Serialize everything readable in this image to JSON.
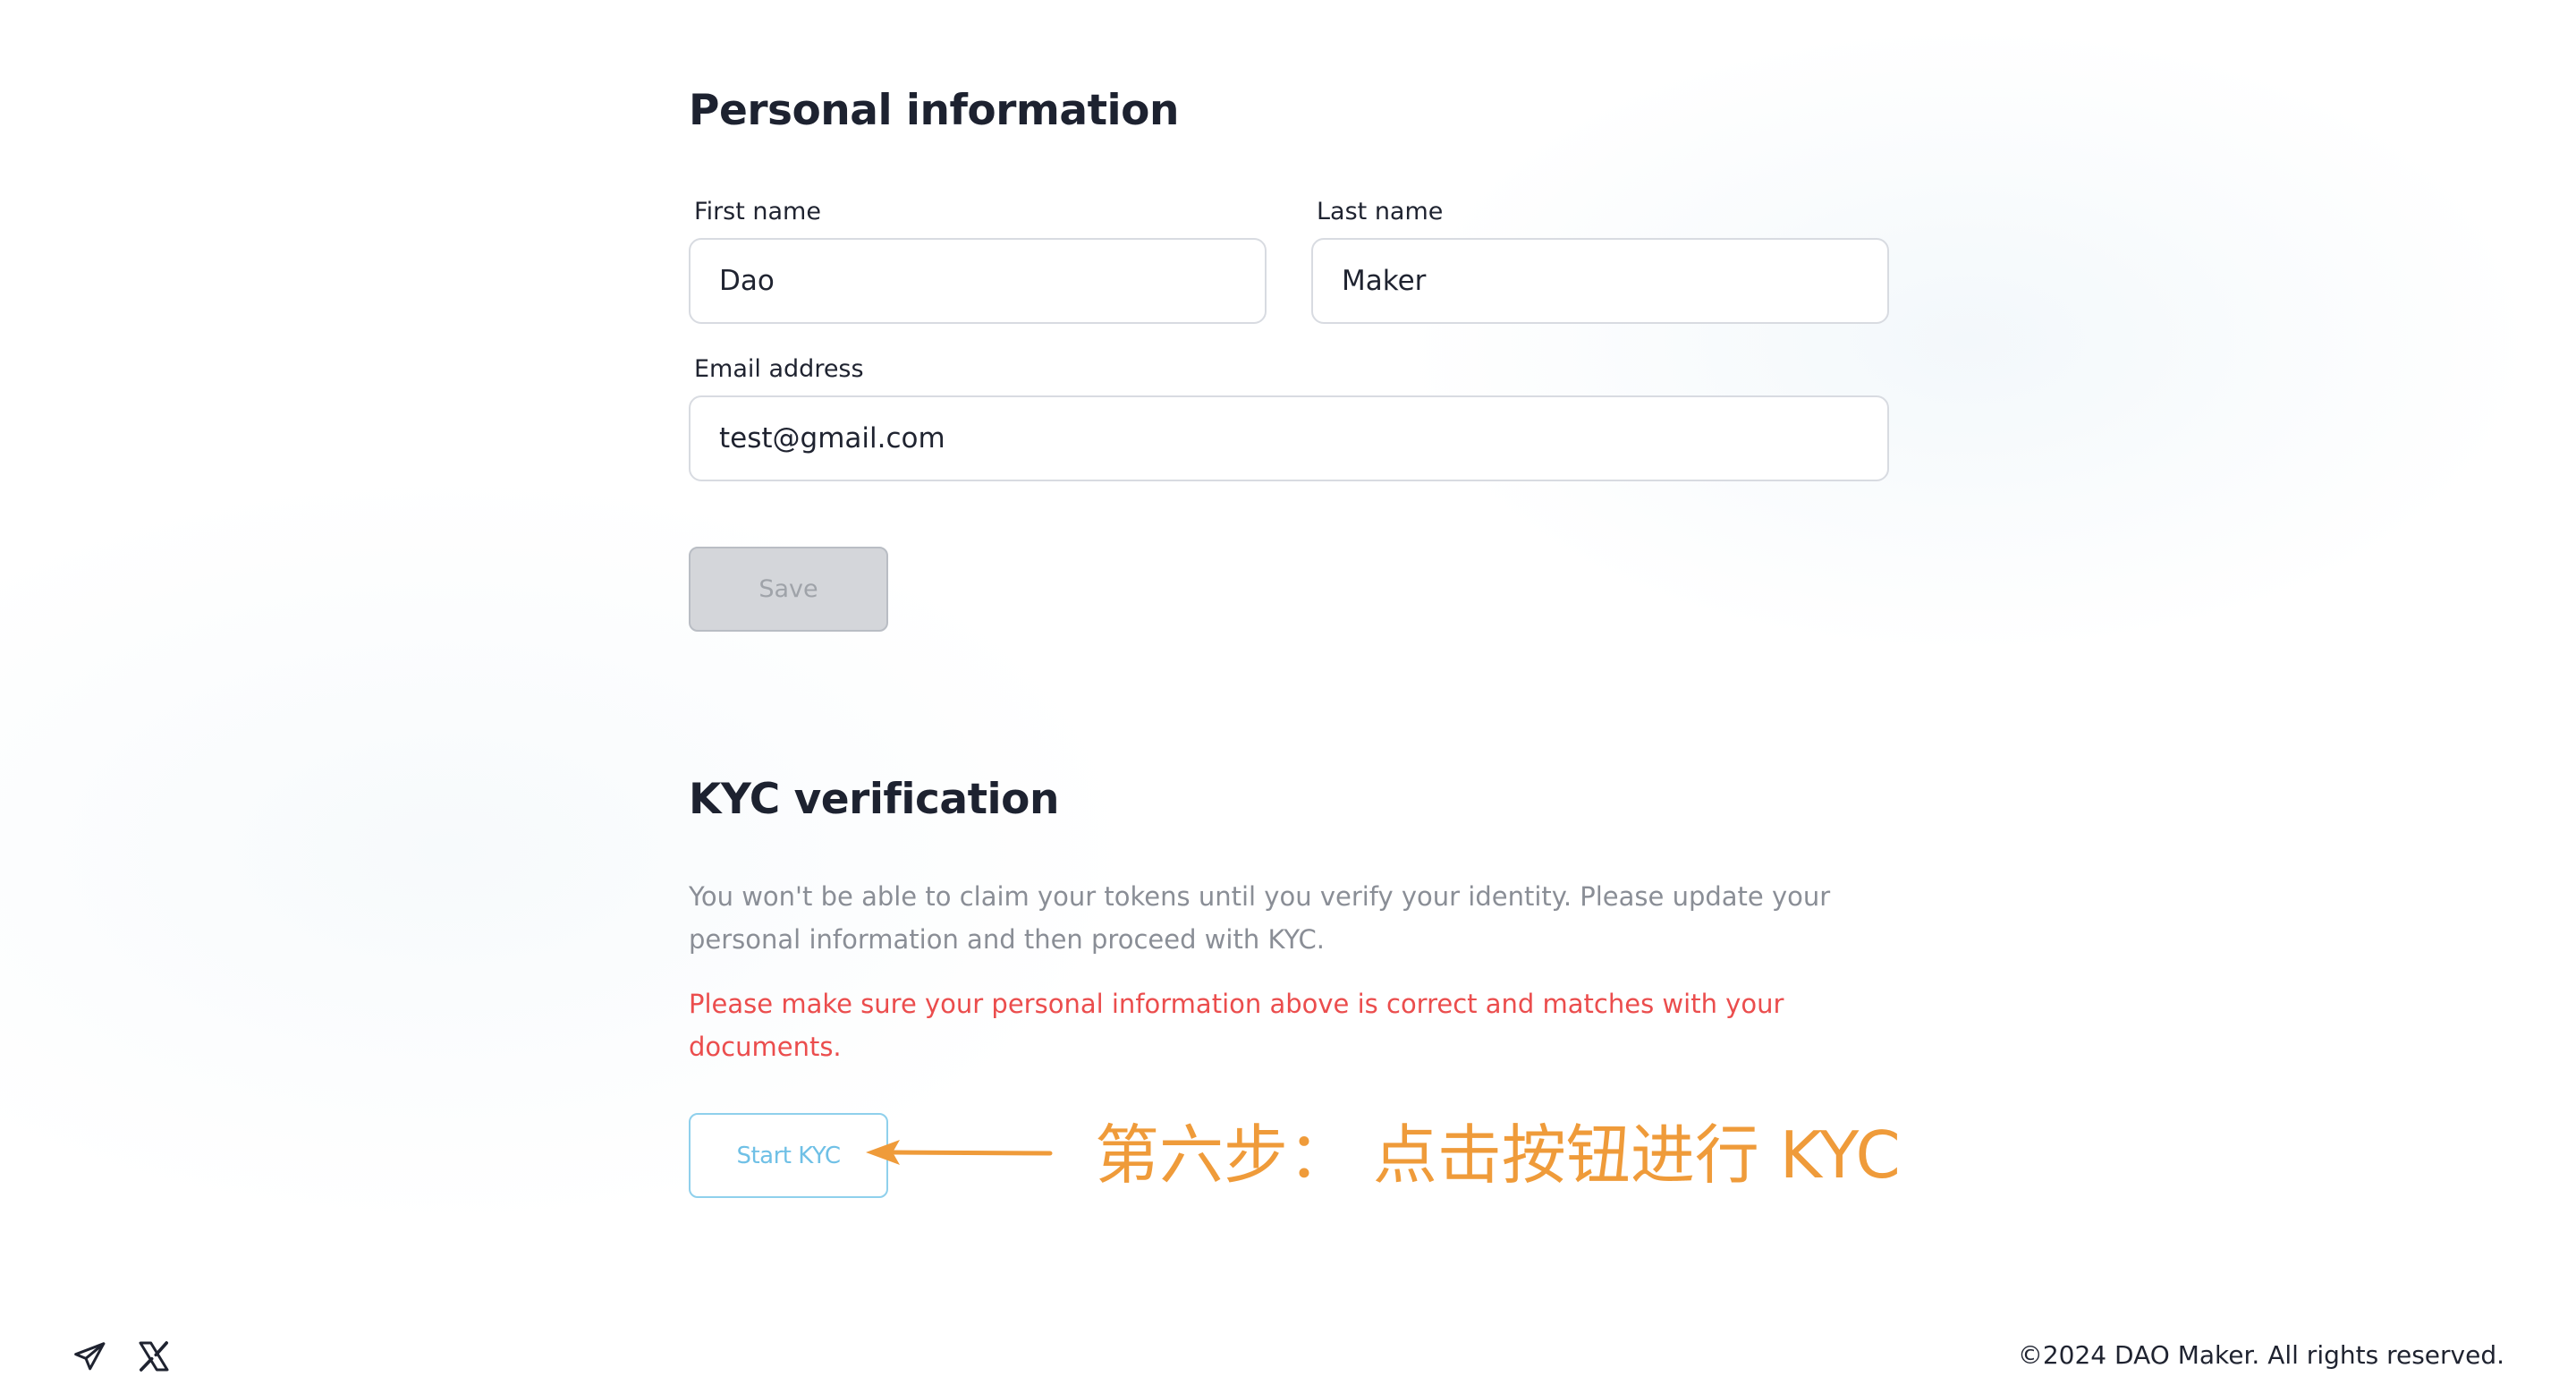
{
  "personal_information": {
    "title": "Personal information",
    "first_name": {
      "label": "First name",
      "value": "Dao"
    },
    "last_name": {
      "label": "Last name",
      "value": "Maker"
    },
    "email": {
      "label": "Email address",
      "value": "test@gmail.com"
    },
    "save_label": "Save"
  },
  "kyc": {
    "title": "KYC verification",
    "description": "You won't be able to claim your tokens until you verify your identity. Please update your personal information and then proceed with KYC.",
    "warning": "Please make sure your personal information above is correct and matches with your documents.",
    "start_label": "Start KYC"
  },
  "annotation": {
    "text": "第六步： 点击按钮进行 KYC",
    "color": "#ef9b3a"
  },
  "footer": {
    "icons": [
      "telegram-icon",
      "x-icon"
    ],
    "copyright": "©2024 DAO Maker. All rights reserved."
  },
  "colors": {
    "text": "#1f2330",
    "muted": "#8a8e96",
    "warning": "#eb4d4d",
    "kyc_accent": "#6fc0e6",
    "disabled_bg": "#d4d6da"
  }
}
